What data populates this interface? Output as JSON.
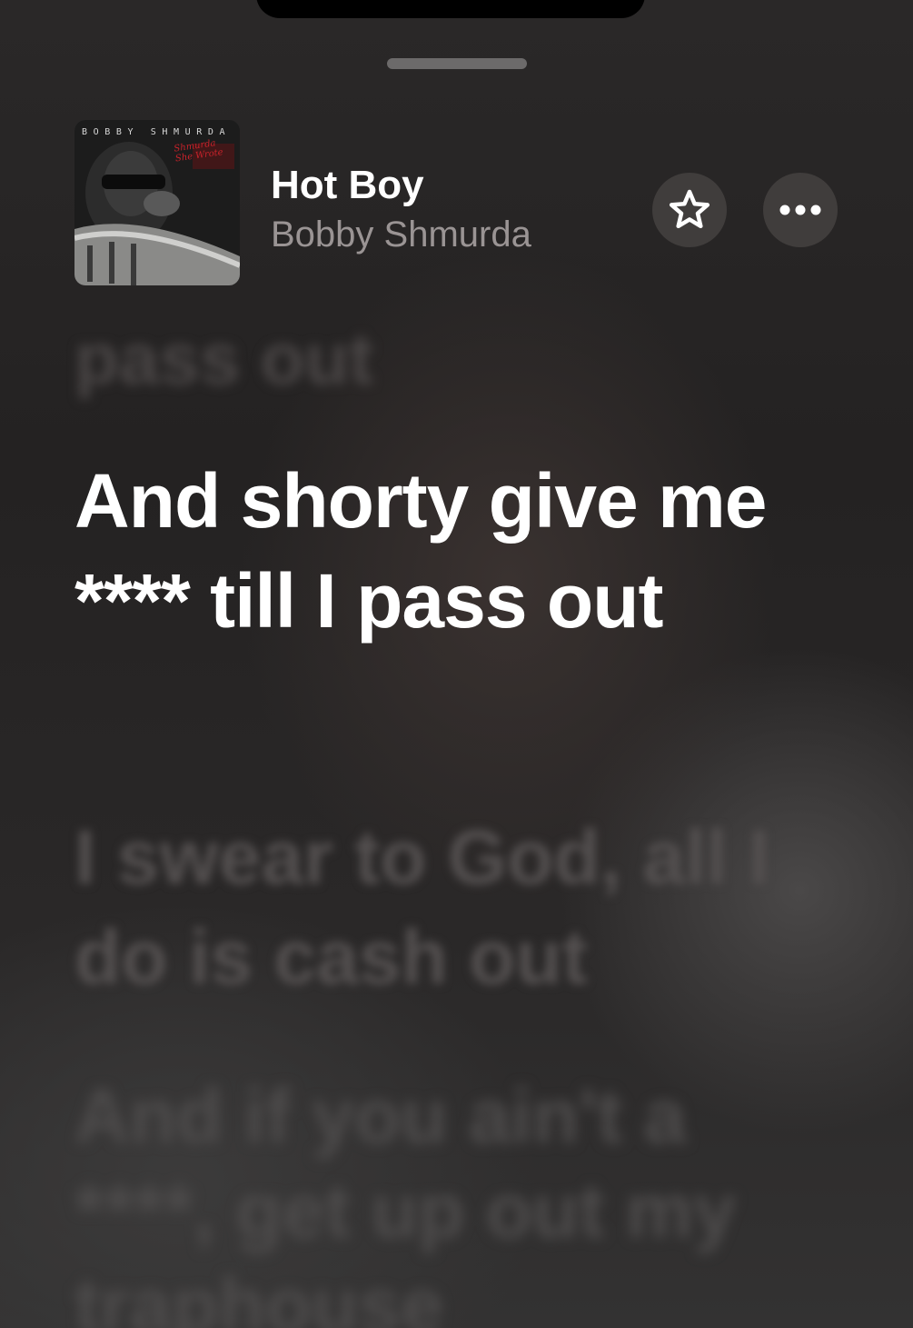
{
  "now_playing": {
    "song_title": "Hot Boy",
    "artist": "Bobby Shmurda",
    "artwork": {
      "artist_text": "BOBBY SHMURDA",
      "title_text": "Shmurda She Wrote"
    }
  },
  "controls": {
    "favorite_icon": "star-icon",
    "more_icon": "ellipsis-icon"
  },
  "lyrics": {
    "previous_line": "pass out",
    "current_line": "And shorty give me **** till I pass out",
    "next_line": "I swear to God, all I do is cash out",
    "following_line": "And if you ain't a ****, get up out my traphouse"
  },
  "colors": {
    "current_lyric": "#ffffff",
    "secondary_text": "#9a9494",
    "button_bg": "#403d3c"
  }
}
